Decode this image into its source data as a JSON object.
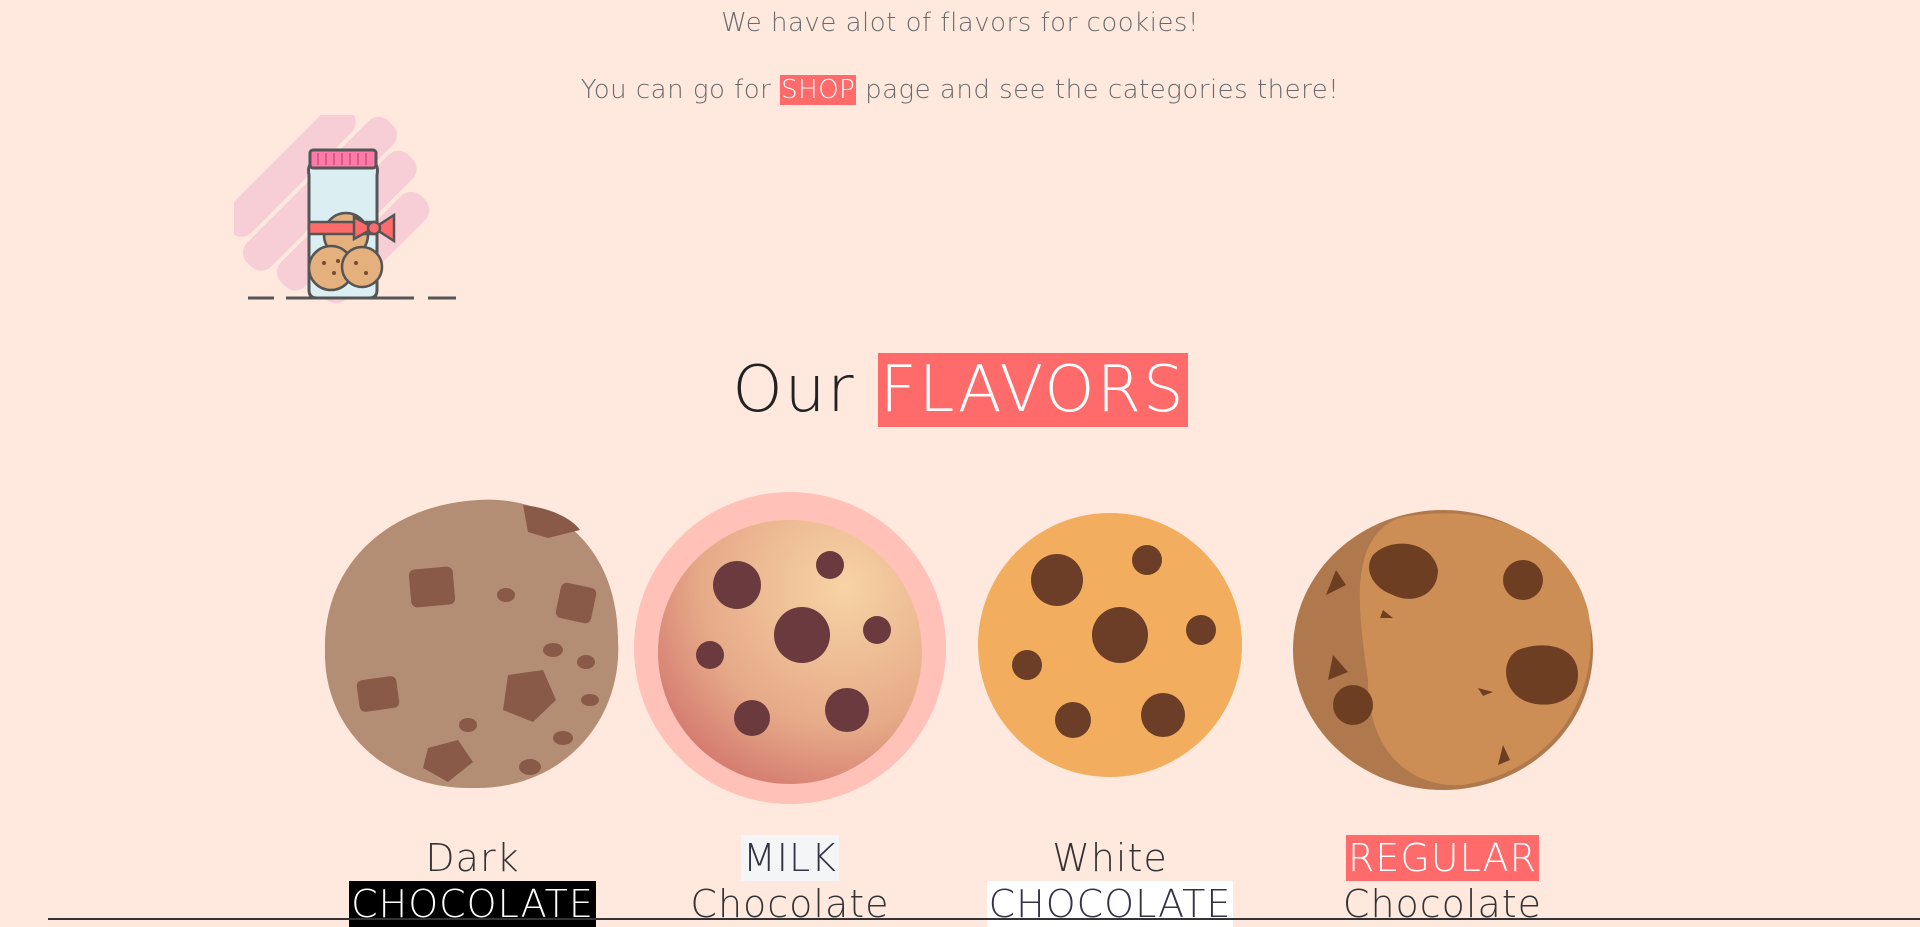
{
  "intro": {
    "line1": "We have alot of flavors for cookies!",
    "line2_before": "You can go for ",
    "line2_highlight": "SHOP",
    "line2_after": " page and see the categories there!"
  },
  "heading": {
    "plain": "Our ",
    "highlight": "FLAVORS"
  },
  "flavors": [
    {
      "line1": "Dark",
      "line2": "CHOCOLATE",
      "icon": "dark-chocolate-cookie"
    },
    {
      "line1": "MILK",
      "line2": "Chocolate",
      "icon": "milk-chocolate-cookie"
    },
    {
      "line1": "White",
      "line2": "CHOCOLATE",
      "icon": "white-chocolate-cookie"
    },
    {
      "line1": "REGULAR",
      "line2": "Chocolate",
      "icon": "regular-chocolate-cookie"
    }
  ],
  "colors": {
    "background": "#ffe9de",
    "accent": "#ff6b6b"
  }
}
